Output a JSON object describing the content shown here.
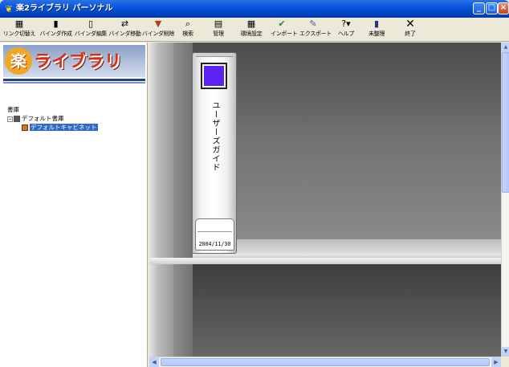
{
  "window": {
    "title": "楽2ライブラリ パーソナル",
    "app_icon": "app-bear-icon",
    "controls": {
      "minimize_icon": "minimize-icon",
      "maximize_icon": "maximize-icon",
      "close_icon": "close-icon"
    }
  },
  "toolbar": {
    "buttons": [
      {
        "label": "リンク切替え",
        "icon": "link-switch-icon"
      },
      {
        "label": "バインダ作成",
        "icon": "binder-create-icon"
      },
      {
        "label": "バインダ編集",
        "icon": "binder-edit-icon"
      },
      {
        "label": "バインダ移動",
        "icon": "binder-move-icon"
      },
      {
        "label": "バインダ削除",
        "icon": "binder-delete-icon"
      },
      {
        "label": "検索",
        "icon": "search-icon"
      },
      {
        "label": "管理",
        "icon": "manage-icon"
      },
      {
        "label": "環境設定",
        "icon": "settings-icon"
      },
      {
        "label": "インポート",
        "icon": "import-icon"
      },
      {
        "label": "エクスポート",
        "icon": "export-icon"
      },
      {
        "label": "ヘルプ",
        "icon": "help-icon"
      },
      {
        "label": "未整理",
        "icon": "unsorted-icon"
      },
      {
        "label": "終了",
        "icon": "exit-icon"
      }
    ]
  },
  "logo": {
    "kanji": "楽",
    "text": "ライブラリ"
  },
  "tree": {
    "root": "書庫",
    "library": "デフォルト書庫",
    "cabinet": "デフォルトキャビネット"
  },
  "binder": {
    "title": "ユーザーズガイド",
    "date": "2004/11/30",
    "color": "#5b22f0"
  },
  "colors": {
    "titlebar": "#0a5ae0",
    "selection": "#316ac5"
  }
}
